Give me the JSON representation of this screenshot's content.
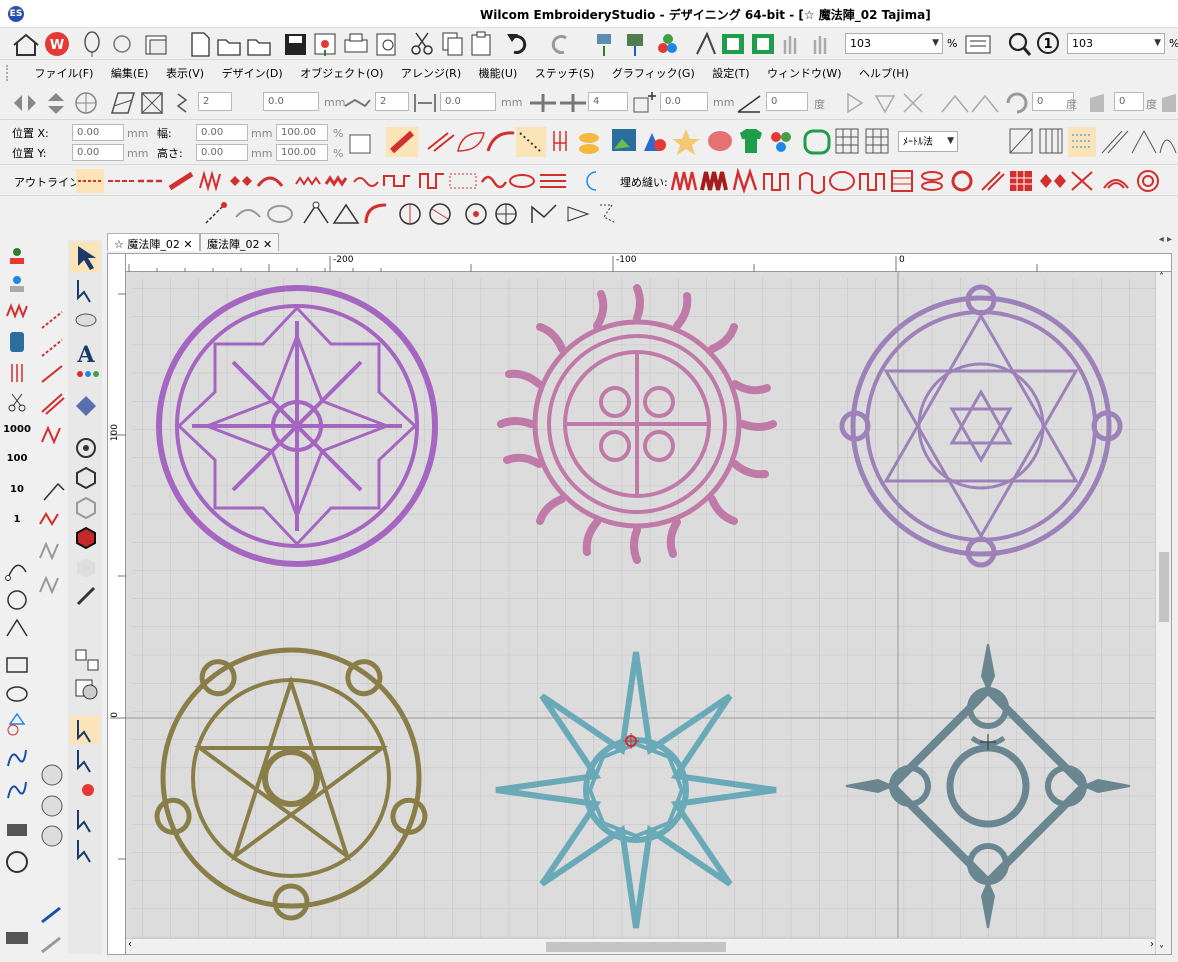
{
  "window": {
    "title": "Wilcom EmbroideryStudio - デザイニング 64-bit - [☆ 魔法陣_02        Tajima]"
  },
  "toolbar_top": {
    "zoom_value": "103",
    "zoom_unit": "%",
    "zoom_value2": "103",
    "zoom_unit2": "%"
  },
  "menu": [
    "ファイル(F)",
    "編集(E)",
    "表示(V)",
    "デザイン(D)",
    "オブジェクト(O)",
    "アレンジ(R)",
    "機能(U)",
    "ステッチ(S)",
    "グラフィック(G)",
    "設定(T)",
    "ウィンドウ(W)",
    "ヘルプ(H)"
  ],
  "arrange_toolbar": {
    "count1": "2",
    "offset1": "0.0",
    "unit_mm": "mm",
    "count2": "2",
    "offset2": "0.0",
    "count3": "4",
    "offset3": "0.0",
    "angle1": "0",
    "angle_unit": "度",
    "angle2": "0",
    "angle3": "0"
  },
  "props": {
    "pos_x_label": "位置 X:",
    "pos_y_label": "位置 Y:",
    "pos_x": "0.00",
    "pos_y": "0.00",
    "unit": "mm",
    "width_label": "幅:",
    "height_label": "高さ:",
    "width": "0.00",
    "height": "0.00",
    "scale_w": "100.00",
    "scale_h": "100.00",
    "pct": "%",
    "units_select": "ﾒｰﾄﾙ法"
  },
  "stitch_bar": {
    "outline_label": "アウトライン:",
    "fill_label": "埋め縫い:"
  },
  "tabs": [
    "☆ 魔法陣_02",
    "魔法陣_02"
  ],
  "ruler": {
    "h_labels": [
      "-200",
      "-100",
      "0"
    ],
    "v_labels": [
      "100",
      "0"
    ]
  },
  "left_tools": {
    "num1000": "1000",
    "num100": "100",
    "num10": "10",
    "num1": "1"
  },
  "designs": [
    {
      "name": "purple-rose-circle",
      "color": "#a466c0"
    },
    {
      "name": "pink-sun-circle",
      "color": "#c07aa8"
    },
    {
      "name": "lavender-hexagram-circle",
      "color": "#9c82b8"
    },
    {
      "name": "olive-pentagram-circle",
      "color": "#8a7e48"
    },
    {
      "name": "teal-star-circle",
      "color": "#6aaab8"
    },
    {
      "name": "slate-moon-circle",
      "color": "#6a8690"
    }
  ]
}
